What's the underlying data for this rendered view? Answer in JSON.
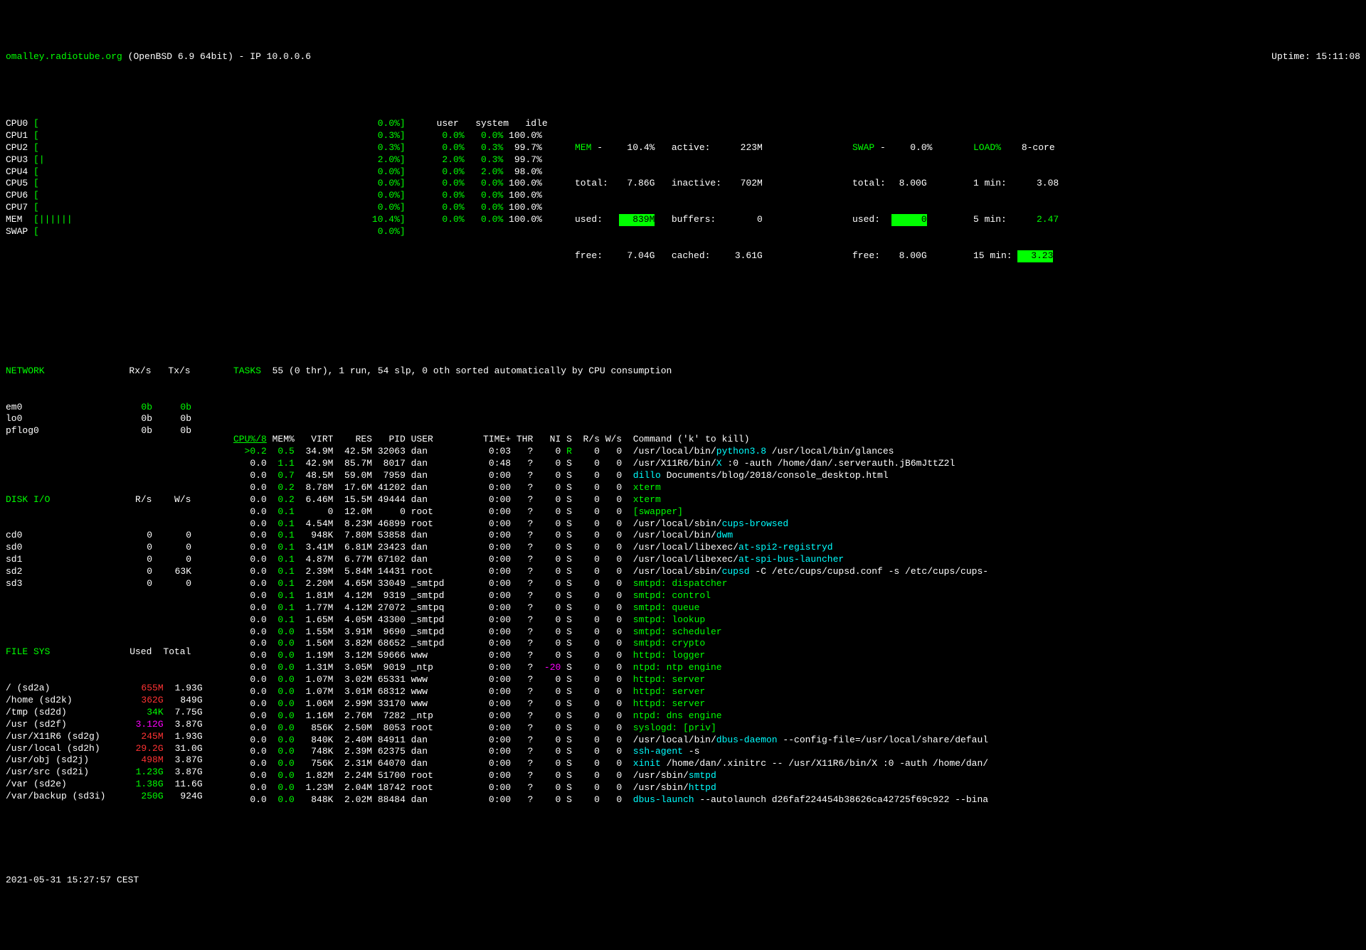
{
  "header": {
    "hostname": "omalley.radiotube.org",
    "os": "(OpenBSD 6.9 64bit) - IP 10.0.0.6",
    "uptime_label": "Uptime:",
    "uptime": "15:11:08"
  },
  "cpus": [
    {
      "name": "CPU0",
      "bar": "[",
      "pct": "0.0%]"
    },
    {
      "name": "CPU1",
      "bar": "[",
      "pct": "0.3%]"
    },
    {
      "name": "CPU2",
      "bar": "[",
      "pct": "0.3%]"
    },
    {
      "name": "CPU3",
      "bar": "[|",
      "pct": "2.0%]"
    },
    {
      "name": "CPU4",
      "bar": "[",
      "pct": "0.0%]"
    },
    {
      "name": "CPU5",
      "bar": "[",
      "pct": "0.0%]"
    },
    {
      "name": "CPU6",
      "bar": "[",
      "pct": "0.0%]"
    },
    {
      "name": "CPU7",
      "bar": "[",
      "pct": "0.0%]"
    },
    {
      "name": "MEM ",
      "bar": "[||||||",
      "pct": "10.4%]"
    },
    {
      "name": "SWAP",
      "bar": "[",
      "pct": "0.0%]"
    }
  ],
  "usi_hdr": {
    "user": "user",
    "system": "system",
    "idle": "idle"
  },
  "usi": [
    {
      "u": "0.0%",
      "s": "0.0%",
      "i": "100.0%"
    },
    {
      "u": "0.0%",
      "s": "0.3%",
      "i": "99.7%"
    },
    {
      "u": "2.0%",
      "s": "0.3%",
      "i": "99.7%"
    },
    {
      "u": "0.0%",
      "s": "2.0%",
      "i": "98.0%"
    },
    {
      "u": "0.0%",
      "s": "0.0%",
      "i": "100.0%"
    },
    {
      "u": "0.0%",
      "s": "0.0%",
      "i": "100.0%"
    },
    {
      "u": "0.0%",
      "s": "0.0%",
      "i": "100.0%"
    },
    {
      "u": "0.0%",
      "s": "0.0%",
      "i": "100.0%"
    }
  ],
  "mem": {
    "title": "MEM",
    "dash": "-",
    "pct": "10.4%",
    "total_l": "total:",
    "total": "7.86G",
    "used_l": "used:",
    "used": "839M",
    "free_l": "free:",
    "free": "7.04G",
    "active_l": "active:",
    "active": "223M",
    "inactive_l": "inactive:",
    "inactive": "702M",
    "buffers_l": "buffers:",
    "buffers": "0",
    "cached_l": "cached:",
    "cached": "3.61G"
  },
  "swap": {
    "title": "SWAP",
    "dash": "-",
    "pct": "0.0%",
    "total_l": "total:",
    "total": "8.00G",
    "used_l": "used:",
    "used": "0",
    "free_l": "free:",
    "free": "8.00G"
  },
  "load": {
    "title": "LOAD%",
    "core": "8-core",
    "m1_l": "1 min:",
    "m1": "3.08",
    "m5_l": "5 min:",
    "m5": "2.47",
    "m15_l": "15 min:",
    "m15": "3.23"
  },
  "network": {
    "title": "NETWORK",
    "rx": "Rx/s",
    "tx": "Tx/s",
    "rows": [
      {
        "if": "em0",
        "rx": "0b",
        "tx": "0b",
        "cls": "green"
      },
      {
        "if": "lo0",
        "rx": "0b",
        "tx": "0b"
      },
      {
        "if": "pflog0",
        "rx": "0b",
        "tx": "0b"
      }
    ]
  },
  "diskio": {
    "title": "DISK I/O",
    "r": "R/s",
    "w": "W/s",
    "rows": [
      {
        "d": "cd0",
        "r": "0",
        "w": "0"
      },
      {
        "d": "sd0",
        "r": "0",
        "w": "0"
      },
      {
        "d": "sd1",
        "r": "0",
        "w": "0"
      },
      {
        "d": "sd2",
        "r": "0",
        "w": "63K"
      },
      {
        "d": "sd3",
        "r": "0",
        "w": "0"
      }
    ]
  },
  "filesys": {
    "title": "FILE SYS",
    "used": "Used",
    "total": "Total",
    "rows": [
      {
        "m": "/ (sd2a)",
        "u": "655M",
        "t": "1.93G",
        "cls": "red"
      },
      {
        "m": "/home (sd2k)",
        "u": "362G",
        "t": "849G",
        "cls": "red"
      },
      {
        "m": "/tmp (sd2d)",
        "u": "34K",
        "t": "7.75G",
        "cls": "green"
      },
      {
        "m": "/usr (sd2f)",
        "u": "3.12G",
        "t": "3.87G",
        "cls": "magenta"
      },
      {
        "m": "/usr/X11R6 (sd2g)",
        "u": "245M",
        "t": "1.93G",
        "cls": "red"
      },
      {
        "m": "/usr/local (sd2h)",
        "u": "29.2G",
        "t": "31.0G",
        "cls": "red"
      },
      {
        "m": "/usr/obj (sd2j)",
        "u": "498M",
        "t": "3.87G",
        "cls": "red"
      },
      {
        "m": "/usr/src (sd2i)",
        "u": "1.23G",
        "t": "3.87G",
        "cls": "green"
      },
      {
        "m": "/var (sd2e)",
        "u": "1.38G",
        "t": "11.6G",
        "cls": "green"
      },
      {
        "m": "/var/backup (sd3i)",
        "u": "250G",
        "t": "924G",
        "cls": "green"
      }
    ]
  },
  "tasks": {
    "title": "TASKS",
    "summary": "55 (0 thr), 1 run, 54 slp, 0 oth sorted automatically by CPU consumption"
  },
  "proc_hdr": {
    "cpu": "CPU%/8",
    "mem": "MEM%",
    "virt": "VIRT",
    "res": "RES",
    "pid": "PID",
    "user": "USER",
    "time": "TIME+",
    "thr": "THR",
    "ni": "NI",
    "s": "S",
    "rs": "R/s",
    "ws": "W/s",
    "cmd": "Command ('k' to kill)"
  },
  "processes": [
    {
      "cpu": ">0.2",
      "mem": "0.5",
      "virt": "34.9M",
      "res": "42.5M",
      "pid": "32063",
      "user": "dan",
      "time": "0:03",
      "thr": "?",
      "ni": "0",
      "s": "R",
      "rs": "0",
      "ws": "0",
      "cmd": [
        {
          "t": "/usr/local/bin/"
        },
        {
          "t": "python3.8",
          "c": "cyan"
        },
        {
          "t": " /usr/local/bin/glances"
        }
      ]
    },
    {
      "cpu": "0.0",
      "mem": "1.1",
      "virt": "42.9M",
      "res": "85.7M",
      "pid": "8017",
      "user": "dan",
      "time": "0:48",
      "thr": "?",
      "ni": "0",
      "s": "S",
      "rs": "0",
      "ws": "0",
      "cmd": [
        {
          "t": "/usr/X11R6/bin/"
        },
        {
          "t": "X",
          "c": "cyan"
        },
        {
          "t": " :0 -auth /home/dan/.serverauth.jB6mJttZ2l"
        }
      ]
    },
    {
      "cpu": "0.0",
      "mem": "0.7",
      "virt": "48.5M",
      "res": "59.0M",
      "pid": "7959",
      "user": "dan",
      "time": "0:00",
      "thr": "?",
      "ni": "0",
      "s": "S",
      "rs": "0",
      "ws": "0",
      "cmd": [
        {
          "t": "dillo",
          "c": "cyan"
        },
        {
          "t": " Documents/blog/2018/console_desktop.html"
        }
      ]
    },
    {
      "cpu": "0.0",
      "mem": "0.2",
      "virt": "8.78M",
      "res": "17.6M",
      "pid": "41202",
      "user": "dan",
      "time": "0:00",
      "thr": "?",
      "ni": "0",
      "s": "S",
      "rs": "0",
      "ws": "0",
      "cmd": [
        {
          "t": "xterm",
          "c": "green"
        }
      ]
    },
    {
      "cpu": "0.0",
      "mem": "0.2",
      "virt": "6.46M",
      "res": "15.5M",
      "pid": "49444",
      "user": "dan",
      "time": "0:00",
      "thr": "?",
      "ni": "0",
      "s": "S",
      "rs": "0",
      "ws": "0",
      "cmd": [
        {
          "t": "xterm",
          "c": "green"
        }
      ]
    },
    {
      "cpu": "0.0",
      "mem": "0.1",
      "virt": "0",
      "res": "12.0M",
      "pid": "0",
      "user": "root",
      "time": "0:00",
      "thr": "?",
      "ni": "0",
      "s": "S",
      "rs": "0",
      "ws": "0",
      "cmd": [
        {
          "t": "[swapper]",
          "c": "green"
        }
      ]
    },
    {
      "cpu": "0.0",
      "mem": "0.1",
      "virt": "4.54M",
      "res": "8.23M",
      "pid": "46899",
      "user": "root",
      "time": "0:00",
      "thr": "?",
      "ni": "0",
      "s": "S",
      "rs": "0",
      "ws": "0",
      "cmd": [
        {
          "t": "/usr/local/sbin/"
        },
        {
          "t": "cups-browsed",
          "c": "cyan"
        }
      ]
    },
    {
      "cpu": "0.0",
      "mem": "0.1",
      "virt": "948K",
      "res": "7.80M",
      "pid": "53858",
      "user": "dan",
      "time": "0:00",
      "thr": "?",
      "ni": "0",
      "s": "S",
      "rs": "0",
      "ws": "0",
      "cmd": [
        {
          "t": "/usr/local/bin/"
        },
        {
          "t": "dwm",
          "c": "cyan"
        }
      ]
    },
    {
      "cpu": "0.0",
      "mem": "0.1",
      "virt": "3.41M",
      "res": "6.81M",
      "pid": "23423",
      "user": "dan",
      "time": "0:00",
      "thr": "?",
      "ni": "0",
      "s": "S",
      "rs": "0",
      "ws": "0",
      "cmd": [
        {
          "t": "/usr/local/libexec/"
        },
        {
          "t": "at-spi2-registryd",
          "c": "cyan"
        }
      ]
    },
    {
      "cpu": "0.0",
      "mem": "0.1",
      "virt": "4.87M",
      "res": "6.77M",
      "pid": "67102",
      "user": "dan",
      "time": "0:00",
      "thr": "?",
      "ni": "0",
      "s": "S",
      "rs": "0",
      "ws": "0",
      "cmd": [
        {
          "t": "/usr/local/libexec/"
        },
        {
          "t": "at-spi-bus-launcher",
          "c": "cyan"
        }
      ]
    },
    {
      "cpu": "0.0",
      "mem": "0.1",
      "virt": "2.39M",
      "res": "5.84M",
      "pid": "14431",
      "user": "root",
      "time": "0:00",
      "thr": "?",
      "ni": "0",
      "s": "S",
      "rs": "0",
      "ws": "0",
      "cmd": [
        {
          "t": "/usr/local/sbin/"
        },
        {
          "t": "cupsd",
          "c": "cyan"
        },
        {
          "t": " -C /etc/cups/cupsd.conf -s /etc/cups/cups-"
        }
      ]
    },
    {
      "cpu": "0.0",
      "mem": "0.1",
      "virt": "2.20M",
      "res": "4.65M",
      "pid": "33049",
      "user": "_smtpd",
      "time": "0:00",
      "thr": "?",
      "ni": "0",
      "s": "S",
      "rs": "0",
      "ws": "0",
      "cmd": [
        {
          "t": "smtpd: dispatcher",
          "c": "green"
        }
      ]
    },
    {
      "cpu": "0.0",
      "mem": "0.1",
      "virt": "1.81M",
      "res": "4.12M",
      "pid": "9319",
      "user": "_smtpd",
      "time": "0:00",
      "thr": "?",
      "ni": "0",
      "s": "S",
      "rs": "0",
      "ws": "0",
      "cmd": [
        {
          "t": "smtpd: control",
          "c": "green"
        }
      ]
    },
    {
      "cpu": "0.0",
      "mem": "0.1",
      "virt": "1.77M",
      "res": "4.12M",
      "pid": "27072",
      "user": "_smtpq",
      "time": "0:00",
      "thr": "?",
      "ni": "0",
      "s": "S",
      "rs": "0",
      "ws": "0",
      "cmd": [
        {
          "t": "smtpd: queue",
          "c": "green"
        }
      ]
    },
    {
      "cpu": "0.0",
      "mem": "0.1",
      "virt": "1.65M",
      "res": "4.05M",
      "pid": "43300",
      "user": "_smtpd",
      "time": "0:00",
      "thr": "?",
      "ni": "0",
      "s": "S",
      "rs": "0",
      "ws": "0",
      "cmd": [
        {
          "t": "smtpd: lookup",
          "c": "green"
        }
      ]
    },
    {
      "cpu": "0.0",
      "mem": "0.0",
      "virt": "1.55M",
      "res": "3.91M",
      "pid": "9690",
      "user": "_smtpd",
      "time": "0:00",
      "thr": "?",
      "ni": "0",
      "s": "S",
      "rs": "0",
      "ws": "0",
      "cmd": [
        {
          "t": "smtpd: scheduler",
          "c": "green"
        }
      ]
    },
    {
      "cpu": "0.0",
      "mem": "0.0",
      "virt": "1.56M",
      "res": "3.82M",
      "pid": "68652",
      "user": "_smtpd",
      "time": "0:00",
      "thr": "?",
      "ni": "0",
      "s": "S",
      "rs": "0",
      "ws": "0",
      "cmd": [
        {
          "t": "smtpd: crypto",
          "c": "green"
        }
      ]
    },
    {
      "cpu": "0.0",
      "mem": "0.0",
      "virt": "1.19M",
      "res": "3.12M",
      "pid": "59666",
      "user": "www",
      "time": "0:00",
      "thr": "?",
      "ni": "0",
      "s": "S",
      "rs": "0",
      "ws": "0",
      "cmd": [
        {
          "t": "httpd: logger",
          "c": "green"
        }
      ]
    },
    {
      "cpu": "0.0",
      "mem": "0.0",
      "virt": "1.31M",
      "res": "3.05M",
      "pid": "9019",
      "user": "_ntp",
      "time": "0:00",
      "thr": "?",
      "ni": "-20",
      "nic": "magenta",
      "s": "S",
      "rs": "0",
      "ws": "0",
      "cmd": [
        {
          "t": "ntpd: ntp engine",
          "c": "green"
        }
      ]
    },
    {
      "cpu": "0.0",
      "mem": "0.0",
      "virt": "1.07M",
      "res": "3.02M",
      "pid": "65331",
      "user": "www",
      "time": "0:00",
      "thr": "?",
      "ni": "0",
      "s": "S",
      "rs": "0",
      "ws": "0",
      "cmd": [
        {
          "t": "httpd: server",
          "c": "green"
        }
      ]
    },
    {
      "cpu": "0.0",
      "mem": "0.0",
      "virt": "1.07M",
      "res": "3.01M",
      "pid": "68312",
      "user": "www",
      "time": "0:00",
      "thr": "?",
      "ni": "0",
      "s": "S",
      "rs": "0",
      "ws": "0",
      "cmd": [
        {
          "t": "httpd: server",
          "c": "green"
        }
      ]
    },
    {
      "cpu": "0.0",
      "mem": "0.0",
      "virt": "1.06M",
      "res": "2.99M",
      "pid": "33170",
      "user": "www",
      "time": "0:00",
      "thr": "?",
      "ni": "0",
      "s": "S",
      "rs": "0",
      "ws": "0",
      "cmd": [
        {
          "t": "httpd: server",
          "c": "green"
        }
      ]
    },
    {
      "cpu": "0.0",
      "mem": "0.0",
      "virt": "1.16M",
      "res": "2.76M",
      "pid": "7282",
      "user": "_ntp",
      "time": "0:00",
      "thr": "?",
      "ni": "0",
      "s": "S",
      "rs": "0",
      "ws": "0",
      "cmd": [
        {
          "t": "ntpd: dns engine",
          "c": "green"
        }
      ]
    },
    {
      "cpu": "0.0",
      "mem": "0.0",
      "virt": "856K",
      "res": "2.50M",
      "pid": "8053",
      "user": "root",
      "time": "0:00",
      "thr": "?",
      "ni": "0",
      "s": "S",
      "rs": "0",
      "ws": "0",
      "cmd": [
        {
          "t": "syslogd: [priv]",
          "c": "green"
        }
      ]
    },
    {
      "cpu": "0.0",
      "mem": "0.0",
      "virt": "840K",
      "res": "2.40M",
      "pid": "84911",
      "user": "dan",
      "time": "0:00",
      "thr": "?",
      "ni": "0",
      "s": "S",
      "rs": "0",
      "ws": "0",
      "cmd": [
        {
          "t": "/usr/local/bin/"
        },
        {
          "t": "dbus-daemon",
          "c": "cyan"
        },
        {
          "t": " --config-file=/usr/local/share/defaul"
        }
      ]
    },
    {
      "cpu": "0.0",
      "mem": "0.0",
      "virt": "748K",
      "res": "2.39M",
      "pid": "62375",
      "user": "dan",
      "time": "0:00",
      "thr": "?",
      "ni": "0",
      "s": "S",
      "rs": "0",
      "ws": "0",
      "cmd": [
        {
          "t": "ssh-agent",
          "c": "cyan"
        },
        {
          "t": " -s"
        }
      ]
    },
    {
      "cpu": "0.0",
      "mem": "0.0",
      "virt": "756K",
      "res": "2.31M",
      "pid": "64070",
      "user": "dan",
      "time": "0:00",
      "thr": "?",
      "ni": "0",
      "s": "S",
      "rs": "0",
      "ws": "0",
      "cmd": [
        {
          "t": "xinit",
          "c": "cyan"
        },
        {
          "t": " /home/dan/.xinitrc -- /usr/X11R6/bin/X :0 -auth /home/dan/"
        }
      ]
    },
    {
      "cpu": "0.0",
      "mem": "0.0",
      "virt": "1.82M",
      "res": "2.24M",
      "pid": "51700",
      "user": "root",
      "time": "0:00",
      "thr": "?",
      "ni": "0",
      "s": "S",
      "rs": "0",
      "ws": "0",
      "cmd": [
        {
          "t": "/usr/sbin/"
        },
        {
          "t": "smtpd",
          "c": "cyan"
        }
      ]
    },
    {
      "cpu": "0.0",
      "mem": "0.0",
      "virt": "1.23M",
      "res": "2.04M",
      "pid": "18742",
      "user": "root",
      "time": "0:00",
      "thr": "?",
      "ni": "0",
      "s": "S",
      "rs": "0",
      "ws": "0",
      "cmd": [
        {
          "t": "/usr/sbin/"
        },
        {
          "t": "httpd",
          "c": "cyan"
        }
      ]
    },
    {
      "cpu": "0.0",
      "mem": "0.0",
      "virt": "848K",
      "res": "2.02M",
      "pid": "88484",
      "user": "dan",
      "time": "0:00",
      "thr": "?",
      "ni": "0",
      "s": "S",
      "rs": "0",
      "ws": "0",
      "cmd": [
        {
          "t": "dbus-launch",
          "c": "cyan"
        },
        {
          "t": " --autolaunch d26faf224454b38626ca42725f69c922 --bina"
        }
      ]
    }
  ],
  "footer": "2021-05-31 15:27:57 CEST"
}
